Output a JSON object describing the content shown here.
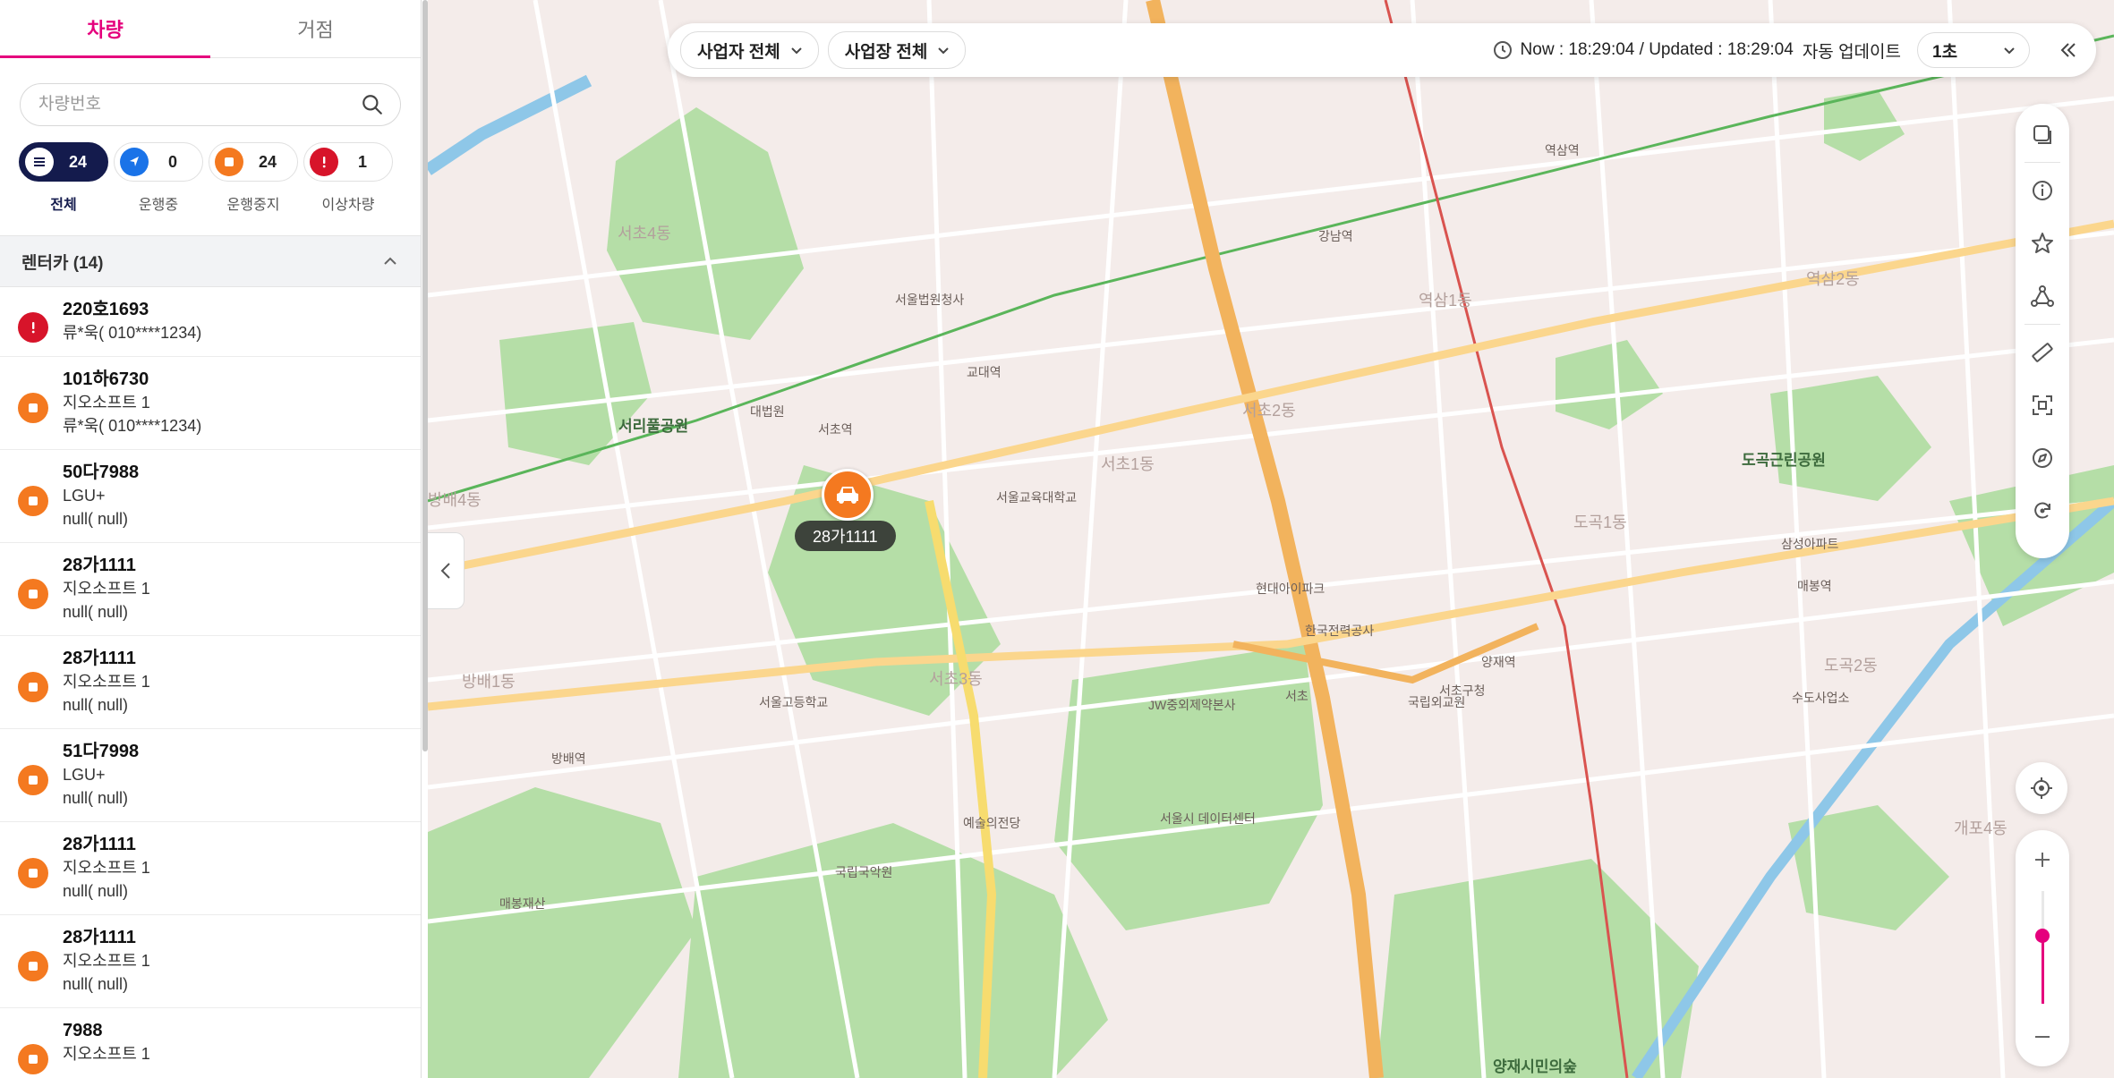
{
  "colors": {
    "accent": "#e5007d",
    "navy": "#141b4d",
    "alert": "#d7142a",
    "stopped": "#f47920",
    "driving": "#1a73e8",
    "park": "#a8d99a",
    "road_main": "#f2b35d"
  },
  "sidebar": {
    "tabs": [
      {
        "label": "차량",
        "active": true
      },
      {
        "label": "거점",
        "active": false
      }
    ],
    "search": {
      "placeholder": "차량번호",
      "value": ""
    },
    "status_filters": [
      {
        "label": "전체",
        "count": "24",
        "icon": "list-icon",
        "active": true
      },
      {
        "label": "운행중",
        "count": "0",
        "icon": "navigation-arrow-icon",
        "active": false
      },
      {
        "label": "운행중지",
        "count": "24",
        "icon": "stop-square-icon",
        "active": false
      },
      {
        "label": "이상차량",
        "count": "1",
        "icon": "alert-icon",
        "active": false
      }
    ],
    "group": {
      "title": "렌터카 (14)",
      "expanded": true
    },
    "vehicles": [
      {
        "plate": "220호1693",
        "lines": [
          "류*욱( 010****1234)"
        ],
        "status": "alert"
      },
      {
        "plate": "101하6730",
        "lines": [
          "지오소프트 1",
          "류*욱( 010****1234)"
        ],
        "status": "stopped"
      },
      {
        "plate": "50다7988",
        "lines": [
          "LGU+",
          "null( null)"
        ],
        "status": "stopped"
      },
      {
        "plate": "28가1111",
        "lines": [
          "지오소프트 1",
          "null( null)"
        ],
        "status": "stopped"
      },
      {
        "plate": "28가1111",
        "lines": [
          "지오소프트 1",
          "null( null)"
        ],
        "status": "stopped"
      },
      {
        "plate": "51다7998",
        "lines": [
          "LGU+",
          "null( null)"
        ],
        "status": "stopped"
      },
      {
        "plate": "28가1111",
        "lines": [
          "지오소프트 1",
          "null( null)"
        ],
        "status": "stopped"
      },
      {
        "plate": "28가1111",
        "lines": [
          "지오소프트 1",
          "null( null)"
        ],
        "status": "stopped"
      },
      {
        "plate": "7988",
        "lines": [
          "지오소프트 1"
        ],
        "status": "stopped"
      }
    ]
  },
  "topbar": {
    "operator_select": "사업자 전체",
    "site_select": "사업장 전체",
    "now_text": "Now : 18:29:04 / Updated : 18:29:04",
    "auto_update_text": "자동 업데이트",
    "interval": "1초"
  },
  "map": {
    "marker_label": "28가1111",
    "zoom_level": 0.6,
    "labels": [
      {
        "text": "서리풀공원",
        "kind": "big"
      },
      {
        "text": "서초역",
        "kind": "normal"
      },
      {
        "text": "서초1동",
        "kind": "area"
      },
      {
        "text": "서초2동",
        "kind": "area"
      },
      {
        "text": "서초3동",
        "kind": "area"
      },
      {
        "text": "서초4동",
        "kind": "area"
      },
      {
        "text": "방배1동",
        "kind": "area"
      },
      {
        "text": "방배4동",
        "kind": "area"
      },
      {
        "text": "역삼1동",
        "kind": "area"
      },
      {
        "text": "도곡1동",
        "kind": "area"
      },
      {
        "text": "도곡2동",
        "kind": "area"
      },
      {
        "text": "역삼2동",
        "kind": "area"
      },
      {
        "text": "개포4동",
        "kind": "area"
      },
      {
        "text": "도곡근린공원",
        "kind": "big"
      },
      {
        "text": "강남역",
        "kind": "normal"
      },
      {
        "text": "양재역",
        "kind": "normal"
      },
      {
        "text": "교대역",
        "kind": "normal"
      },
      {
        "text": "방배역",
        "kind": "normal"
      },
      {
        "text": "역삼역",
        "kind": "normal"
      },
      {
        "text": "매봉역",
        "kind": "normal"
      },
      {
        "text": "서울교육대학교",
        "kind": "normal"
      },
      {
        "text": "서울고등학교",
        "kind": "normal"
      },
      {
        "text": "대법원",
        "kind": "normal"
      },
      {
        "text": "서울법원청사",
        "kind": "normal"
      },
      {
        "text": "예술의전당",
        "kind": "normal"
      },
      {
        "text": "국립국악원",
        "kind": "normal"
      },
      {
        "text": "서울시 데이터센터",
        "kind": "normal"
      },
      {
        "text": "양재시민의숲",
        "kind": "big"
      },
      {
        "text": "현대아이파크",
        "kind": "normal"
      },
      {
        "text": "한국전력공사",
        "kind": "normal"
      },
      {
        "text": "서초",
        "kind": "normal"
      },
      {
        "text": "JW중외제약본사",
        "kind": "normal"
      },
      {
        "text": "매봉재산",
        "kind": "normal"
      },
      {
        "text": "국립외교원",
        "kind": "normal"
      },
      {
        "text": "서초구청",
        "kind": "normal"
      },
      {
        "text": "수도사업소",
        "kind": "normal"
      },
      {
        "text": "삼성아파트",
        "kind": "normal"
      }
    ]
  }
}
